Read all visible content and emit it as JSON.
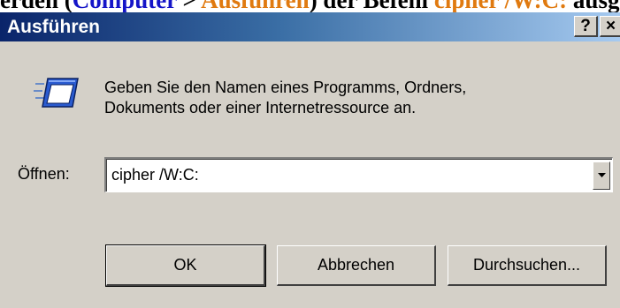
{
  "background": {
    "fragments": [
      {
        "text": "erden (",
        "style": "normal"
      },
      {
        "text": "Computer",
        "style": "blue"
      },
      {
        "text": " > ",
        "style": "normal"
      },
      {
        "text": "Ausführen",
        "style": "orange"
      },
      {
        "text": ") der Befehl ",
        "style": "normal"
      },
      {
        "text": "cipher /W:C:",
        "style": "orange"
      },
      {
        "text": " ausgeführt",
        "style": "normal"
      }
    ]
  },
  "window": {
    "title": "Ausführen",
    "help_button": "?",
    "close_button": "×"
  },
  "icon": "run-program-icon",
  "description": {
    "line1": "Geben Sie den Namen eines Programms, Ordners,",
    "line2": "Dokuments oder einer Internetressource an."
  },
  "open_field": {
    "label": "Öffnen:",
    "value": "cipher /W:C:"
  },
  "buttons": {
    "ok": "OK",
    "cancel": "Abbrechen",
    "browse": "Durchsuchen..."
  },
  "colors": {
    "titlebar_start": "#0a246a",
    "titlebar_end": "#a6caf0",
    "dialog_face": "#d4d0c8",
    "link_blue": "#1515c8",
    "link_orange": "#e07a10"
  }
}
